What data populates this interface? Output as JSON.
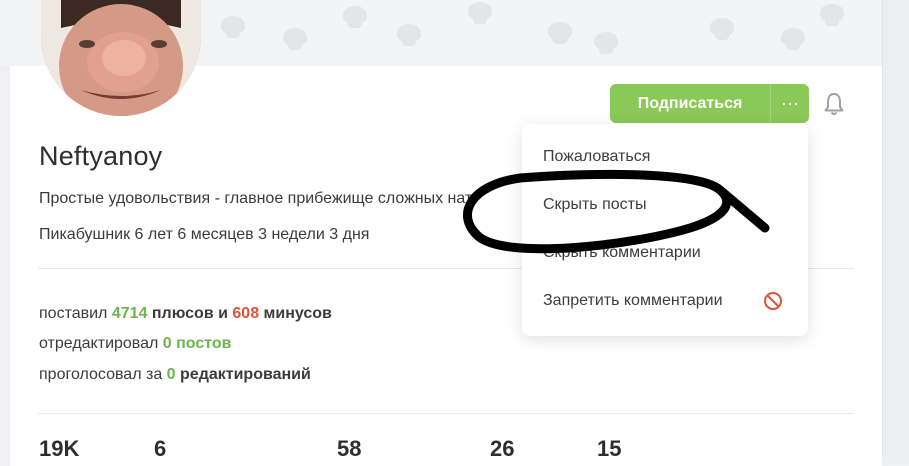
{
  "profile": {
    "username": "Neftyanoy",
    "status": "Простые удовольствия - главное прибежище сложных нат",
    "tenure": "Пикабушник 6 лет 6 месяцев 3 недели 3 дня"
  },
  "stats": {
    "line1": {
      "prefix": "поставил ",
      "pluses": "4714",
      "mid": " плюсов и ",
      "minuses": "608",
      "suffix": " минусов"
    },
    "line2": {
      "prefix": "отредактировал ",
      "value": "0 постов"
    },
    "line3": {
      "prefix": "проголосовал за ",
      "value": "0",
      "suffix": " редактирований"
    }
  },
  "actions": {
    "subscribe_label": "Подписаться",
    "more_label": "···"
  },
  "dropdown": {
    "items": [
      "Пожаловаться",
      "Скрыть посты",
      "Скрыть комментарии",
      "Запретить комментарии"
    ]
  },
  "counters": [
    "19K",
    "6",
    "58",
    "26",
    "15"
  ],
  "colors": {
    "accent_green": "#8ac858",
    "plus_green": "#6bb54f",
    "minus_red": "#e0533a",
    "ban_red": "#e0533a"
  },
  "icons": {
    "more": "ellipsis-icon",
    "bell": "bell-icon",
    "ban": "ban-icon"
  }
}
